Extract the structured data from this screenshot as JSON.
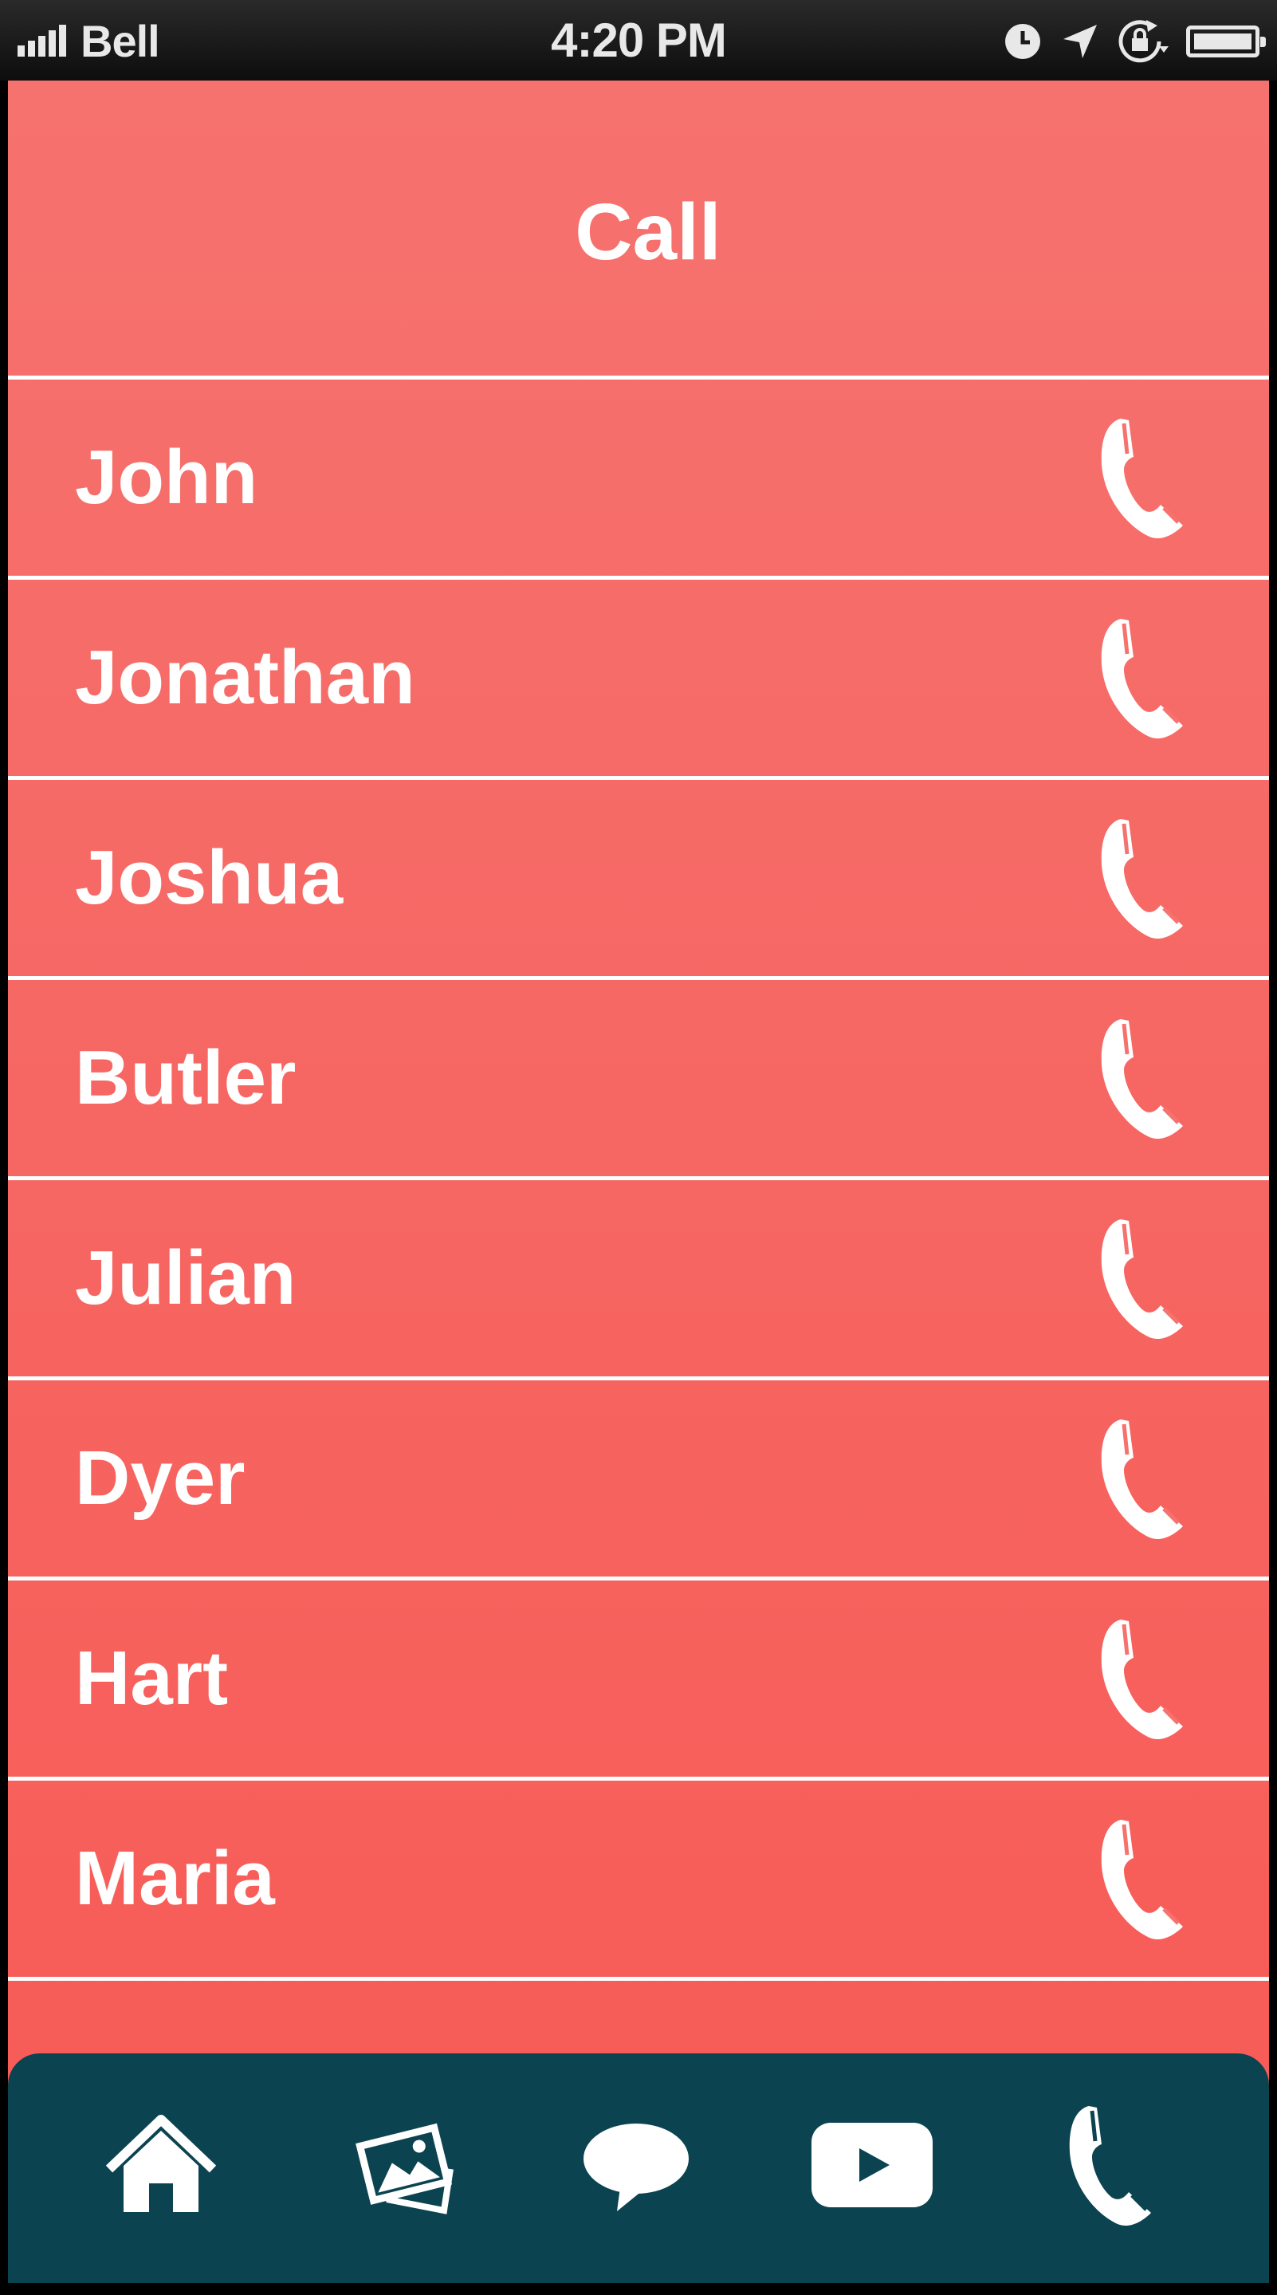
{
  "status_bar": {
    "carrier": "Bell",
    "time": "4:20 PM",
    "icons": [
      "signal-icon",
      "clock-icon",
      "location-arrow-icon",
      "rotation-lock-icon",
      "battery-icon"
    ]
  },
  "header": {
    "title": "Call"
  },
  "contacts": [
    {
      "name": "John",
      "icon": "phone-icon"
    },
    {
      "name": "Jonathan",
      "icon": "phone-icon"
    },
    {
      "name": "Joshua",
      "icon": "phone-icon"
    },
    {
      "name": "Butler",
      "icon": "phone-icon"
    },
    {
      "name": "Julian",
      "icon": "phone-icon"
    },
    {
      "name": "Dyer",
      "icon": "phone-icon"
    },
    {
      "name": "Hart",
      "icon": "phone-icon"
    },
    {
      "name": "Maria",
      "icon": "phone-icon"
    }
  ],
  "tab_bar": {
    "tabs": [
      {
        "icon": "home-icon"
      },
      {
        "icon": "photos-icon"
      },
      {
        "icon": "chat-bubble-icon"
      },
      {
        "icon": "video-play-icon"
      },
      {
        "icon": "phone-icon"
      }
    ]
  },
  "colors": {
    "accent_top": "#f6726f",
    "accent_bottom": "#f75a55",
    "tab_bar": "#0b4351",
    "text": "#ffffff"
  }
}
